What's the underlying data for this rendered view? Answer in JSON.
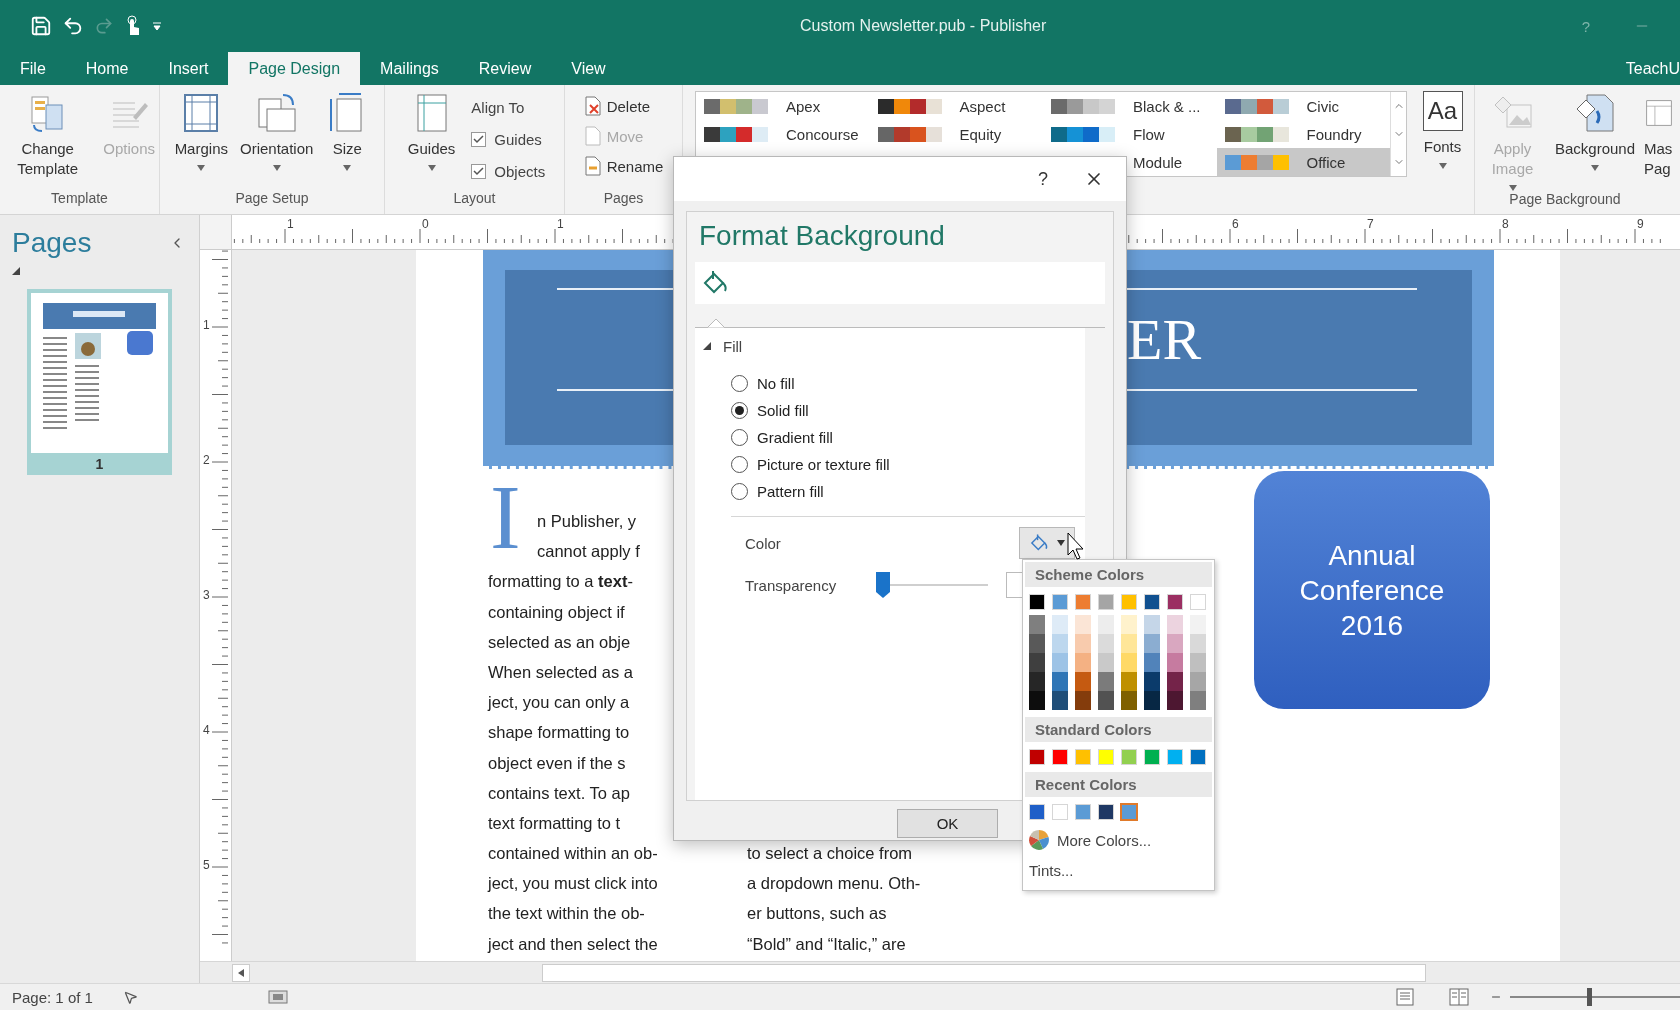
{
  "title_bar": {
    "title": "Custom Newsletter.pub - Publisher",
    "help": "?"
  },
  "tabs": [
    {
      "label": "File",
      "selected": false
    },
    {
      "label": "Home",
      "selected": false
    },
    {
      "label": "Insert",
      "selected": false
    },
    {
      "label": "Page Design",
      "selected": true
    },
    {
      "label": "Mailings",
      "selected": false
    },
    {
      "label": "Review",
      "selected": false
    },
    {
      "label": "View",
      "selected": false
    }
  ],
  "account": "TeachU",
  "ribbon": {
    "template": {
      "label": "Template",
      "buttons": [
        {
          "label": "Change Template",
          "disabled": false
        },
        {
          "label": "Options",
          "disabled": true
        }
      ]
    },
    "page_setup": {
      "label": "Page Setup",
      "buttons": [
        {
          "label": "Margins"
        },
        {
          "label": "Orientation"
        },
        {
          "label": "Size"
        }
      ]
    },
    "layout": {
      "label": "Layout",
      "guides_button": "Guides",
      "align_to": "Align To",
      "checks": [
        {
          "label": "Guides",
          "checked": true
        },
        {
          "label": "Objects",
          "checked": true
        }
      ]
    },
    "pages": {
      "label": "Pages",
      "buttons": [
        {
          "label": "Delete",
          "disabled": false
        },
        {
          "label": "Move",
          "disabled": true
        },
        {
          "label": "Rename",
          "disabled": false
        }
      ]
    },
    "schemes": [
      {
        "name": "Apex",
        "selected": false,
        "colors": [
          {
            "color": "#6b6b6b"
          },
          {
            "color": "#d2bf6e"
          },
          {
            "color": "#9fb38a"
          },
          {
            "color": "#c9c9d0"
          }
        ]
      },
      {
        "name": "Aspect",
        "selected": false,
        "colors": [
          {
            "color": "#2b2b2b"
          },
          {
            "color": "#f0880a"
          },
          {
            "color": "#b32b2b"
          },
          {
            "color": "#e8e1d6"
          }
        ]
      },
      {
        "name": "Black & ...",
        "selected": false,
        "colors": [
          {
            "color": "#6b6b6b"
          },
          {
            "color": "#9a9a9a"
          },
          {
            "color": "#c8c8c8"
          },
          {
            "color": "#d4d4d4"
          }
        ]
      },
      {
        "name": "Civic",
        "selected": false,
        "colors": [
          {
            "color": "#5a6a8f"
          },
          {
            "color": "#8fa9b0"
          },
          {
            "color": "#d25a3c"
          },
          {
            "color": "#b9cdd6"
          }
        ]
      },
      {
        "name": "Concourse",
        "selected": false,
        "colors": [
          {
            "color": "#3a3a3a"
          },
          {
            "color": "#2da2bf"
          },
          {
            "color": "#d42b2b"
          },
          {
            "color": "#deecf5"
          }
        ]
      },
      {
        "name": "Equity",
        "selected": false,
        "colors": [
          {
            "color": "#666666"
          },
          {
            "color": "#b23a2b"
          },
          {
            "color": "#d9531e"
          },
          {
            "color": "#e6e0d9"
          }
        ]
      },
      {
        "name": "Flow",
        "selected": false,
        "colors": [
          {
            "color": "#0f6b8a"
          },
          {
            "color": "#1592d6"
          },
          {
            "color": "#0f6bc9"
          },
          {
            "color": "#d8eef7"
          }
        ]
      },
      {
        "name": "Foundry",
        "selected": false,
        "colors": [
          {
            "color": "#6b6450"
          },
          {
            "color": "#a8cba0"
          },
          {
            "color": "#72a374"
          },
          {
            "color": "#e8e6dc"
          }
        ]
      },
      {
        "name": "Module",
        "selected": false
      },
      {
        "name": "Office",
        "selected": true,
        "colors": [
          {
            "color": "#5b9bd5"
          },
          {
            "color": "#ed7d31"
          },
          {
            "color": "#a5a5a5"
          },
          {
            "color": "#ffc000"
          }
        ]
      }
    ],
    "fonts_icon": "Aa",
    "fonts_button": "Fonts",
    "page_background": {
      "label": "Page Background",
      "buttons": [
        {
          "label": "Apply Image",
          "disabled": true
        },
        {
          "label": "Background",
          "disabled": false
        },
        {
          "label": "Mas Pag",
          "disabled": false
        }
      ]
    }
  },
  "pages_panel": {
    "title": "Pages",
    "pages": [
      {
        "number": "1",
        "selected": true
      }
    ]
  },
  "rulers": {
    "horizontal": [
      "1",
      "0",
      "1",
      "6",
      "7",
      "8",
      "9"
    ],
    "vertical": [
      "1",
      "2",
      "3",
      "4",
      "5"
    ]
  },
  "document": {
    "header_title": "ER",
    "drop_cap": "I",
    "column_1": [
      "n Publisher, y",
      "cannot apply f",
      "formatting to a **text**-",
      "containing object if",
      "selected as an obje",
      "When selected as a",
      "ject, you can only a",
      "shape formatting to",
      "object even if the s",
      "contains text. To ap",
      "text formatting to t",
      "contained within an ob-",
      "ject, you must click into",
      "the text within the ob-",
      "ject and then select the"
    ],
    "column_2": [
      "to select a choice from",
      "a dropdown menu. Oth-",
      "er buttons, such as",
      "“Bold” and “Italic,” are"
    ],
    "callout": "Annual Conference 2016"
  },
  "dialog": {
    "help": "?",
    "title": "Format Background",
    "section": "Fill",
    "expanded": true,
    "fill_options": [
      {
        "label": "No fill",
        "selected": false
      },
      {
        "label": "Solid fill",
        "selected": true
      },
      {
        "label": "Gradient fill",
        "selected": false
      },
      {
        "label": "Picture or texture fill",
        "selected": false
      },
      {
        "label": "Pattern fill",
        "selected": false
      }
    ],
    "color_label": "Color",
    "transparency_label": "Transparency",
    "transparency": {
      "level": 0
    },
    "ok": "OK"
  },
  "color_menu": {
    "scheme_header": "Scheme Colors",
    "scheme": [
      {
        "color": "#000000",
        "shades": [
          {
            "color": "#7f7f7f"
          },
          {
            "color": "#595959"
          },
          {
            "color": "#3f3f3f"
          },
          {
            "color": "#262626"
          },
          {
            "color": "#0d0d0d"
          }
        ]
      },
      {
        "color": "#5b9bd5",
        "shades": [
          {
            "color": "#deebf7"
          },
          {
            "color": "#bdd7ee"
          },
          {
            "color": "#9dc3e6"
          },
          {
            "color": "#2e75b6"
          },
          {
            "color": "#1f4e79"
          }
        ]
      },
      {
        "color": "#ed7d31",
        "shades": [
          {
            "color": "#fbe5d6"
          },
          {
            "color": "#f8cbad"
          },
          {
            "color": "#f4b183"
          },
          {
            "color": "#c55a11"
          },
          {
            "color": "#843c0c"
          }
        ]
      },
      {
        "color": "#a5a5a5",
        "shades": [
          {
            "color": "#ededed"
          },
          {
            "color": "#dbdbdb"
          },
          {
            "color": "#c9c9c9"
          },
          {
            "color": "#7b7b7b"
          },
          {
            "color": "#525252"
          }
        ]
      },
      {
        "color": "#ffc000",
        "shades": [
          {
            "color": "#fff2cc"
          },
          {
            "color": "#ffe699"
          },
          {
            "color": "#ffd966"
          },
          {
            "color": "#bf9000"
          },
          {
            "color": "#7f6000"
          }
        ]
      },
      {
        "color": "#10508f",
        "shades": [
          {
            "color": "#c5d6e8"
          },
          {
            "color": "#8badd1"
          },
          {
            "color": "#5183ba"
          },
          {
            "color": "#0b3b6b"
          },
          {
            "color": "#072744"
          }
        ]
      },
      {
        "color": "#9b2f62",
        "shades": [
          {
            "color": "#ecd3df"
          },
          {
            "color": "#d9a7c0"
          },
          {
            "color": "#c67ba0"
          },
          {
            "color": "#742349"
          },
          {
            "color": "#4d1731"
          }
        ]
      },
      {
        "color": "#ffffff",
        "shades": [
          {
            "color": "#f2f2f2"
          },
          {
            "color": "#d9d9d9"
          },
          {
            "color": "#bfbfbf"
          },
          {
            "color": "#a6a6a6"
          },
          {
            "color": "#7f7f7f"
          }
        ]
      }
    ],
    "standard_header": "Standard Colors",
    "standard": [
      {
        "color": "#c00000"
      },
      {
        "color": "#ff0000"
      },
      {
        "color": "#ffc000"
      },
      {
        "color": "#ffff00"
      },
      {
        "color": "#92d050"
      },
      {
        "color": "#00b050"
      },
      {
        "color": "#00b0f0"
      },
      {
        "color": "#0070c0"
      }
    ],
    "recent_header": "Recent Colors",
    "recent": [
      {
        "color": "#1f5fc8",
        "selected": false
      },
      {
        "color": "#ffffff",
        "selected": false
      },
      {
        "color": "#5b9bd5",
        "selected": false
      },
      {
        "color": "#1f3864",
        "selected": false
      },
      {
        "color": "#5b9bd5",
        "selected": true
      }
    ],
    "more": "More Colors...",
    "tints": "Tints..."
  },
  "status_bar": {
    "page": "Page: 1 of 1",
    "zoom": {
      "level": 0.45
    }
  }
}
